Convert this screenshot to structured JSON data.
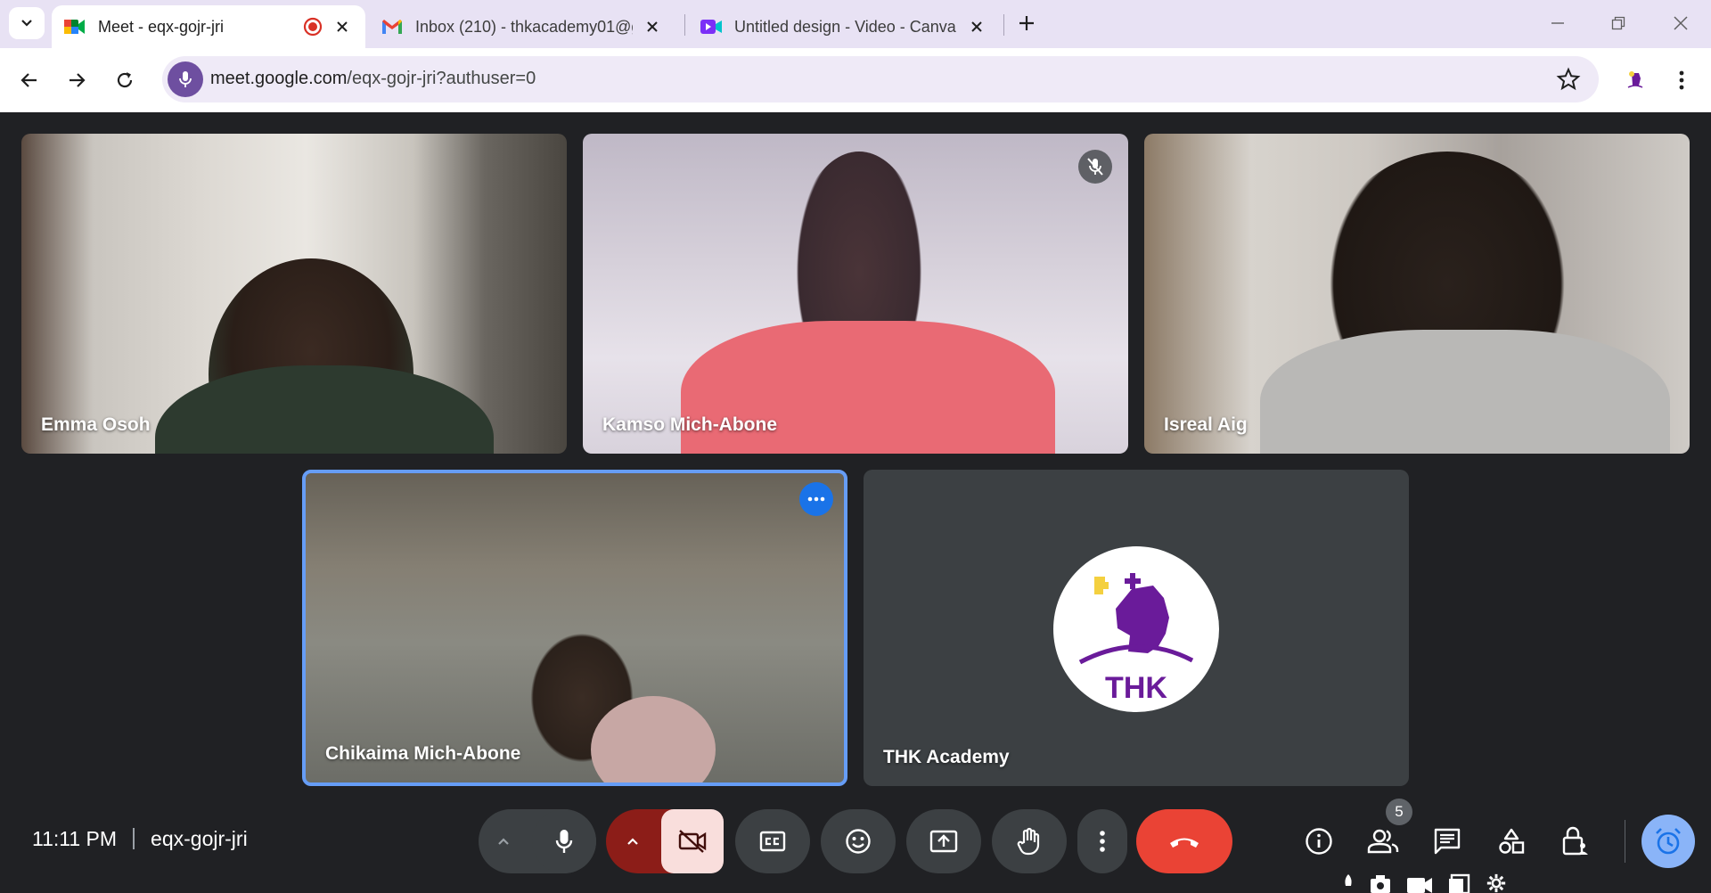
{
  "browser": {
    "tabs": [
      {
        "title": "Meet - eqx-gojr-jri",
        "icon": "google-meet-icon",
        "recording": true,
        "active": true
      },
      {
        "title": "Inbox (210) - thkacademy01@g",
        "icon": "gmail-icon",
        "active": false
      },
      {
        "title": "Untitled design - Video - Canva",
        "icon": "canva-video-icon",
        "active": false
      }
    ],
    "url": {
      "host": "meet.google.com",
      "path": "/eqx-gojr-jri?authuser=0"
    }
  },
  "participants": [
    {
      "name": "Emma Osoh",
      "muted": false
    },
    {
      "name": "Kamso Mich-Abone",
      "muted": true
    },
    {
      "name": "Isreal Aig",
      "muted": false
    },
    {
      "name": "Chikaima Mich-Abone",
      "muted": false,
      "pinned_self": true
    },
    {
      "name": "THK Academy",
      "camera_off": true,
      "avatar_text": "THK"
    }
  ],
  "meeting": {
    "time": "11:11 PM",
    "code": "eqx-gojr-jri",
    "people_count": "5"
  },
  "colors": {
    "accent": "#669df6",
    "end_call": "#ea4335",
    "cam_off_bg": "#8c1d18",
    "cam_off_icon_bg": "#f9dedc",
    "brand_purple": "#6a1b9a",
    "brand_yellow": "#f4d03f"
  }
}
